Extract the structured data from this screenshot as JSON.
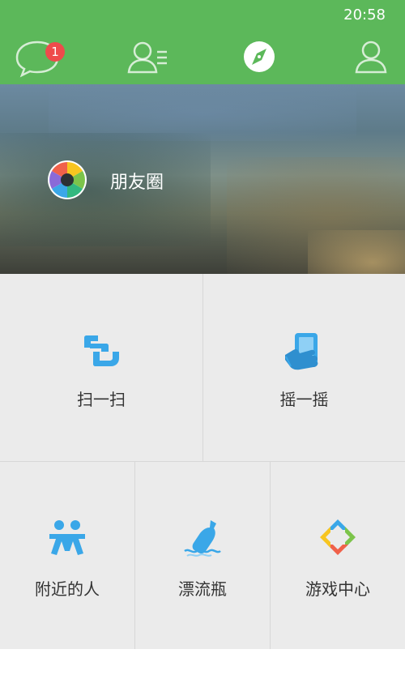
{
  "status_bar": {
    "time": "20:58"
  },
  "top_tabs": {
    "chats_badge": "1",
    "items": [
      {
        "icon": "chat-bubble-icon",
        "active": false
      },
      {
        "icon": "contacts-icon",
        "active": false
      },
      {
        "icon": "compass-icon",
        "active": true
      },
      {
        "icon": "profile-icon",
        "active": false
      }
    ]
  },
  "moments": {
    "label": "朋友圈",
    "icon": "moments-aperture-icon"
  },
  "features": {
    "scan": {
      "label": "扫一扫",
      "icon": "scan-icon"
    },
    "shake": {
      "label": "摇一摇",
      "icon": "shake-phone-icon"
    },
    "nearby": {
      "label": "附近的人",
      "icon": "people-nearby-icon"
    },
    "bottle": {
      "label": "漂流瓶",
      "icon": "drift-bottle-icon"
    },
    "games": {
      "label": "游戏中心",
      "icon": "game-center-icon"
    }
  },
  "colors": {
    "top_bar": "#5cb85a",
    "badge": "#ee4b4b",
    "feature_icon_blue": "#3aa7e8",
    "grid_background": "#ebebeb"
  }
}
